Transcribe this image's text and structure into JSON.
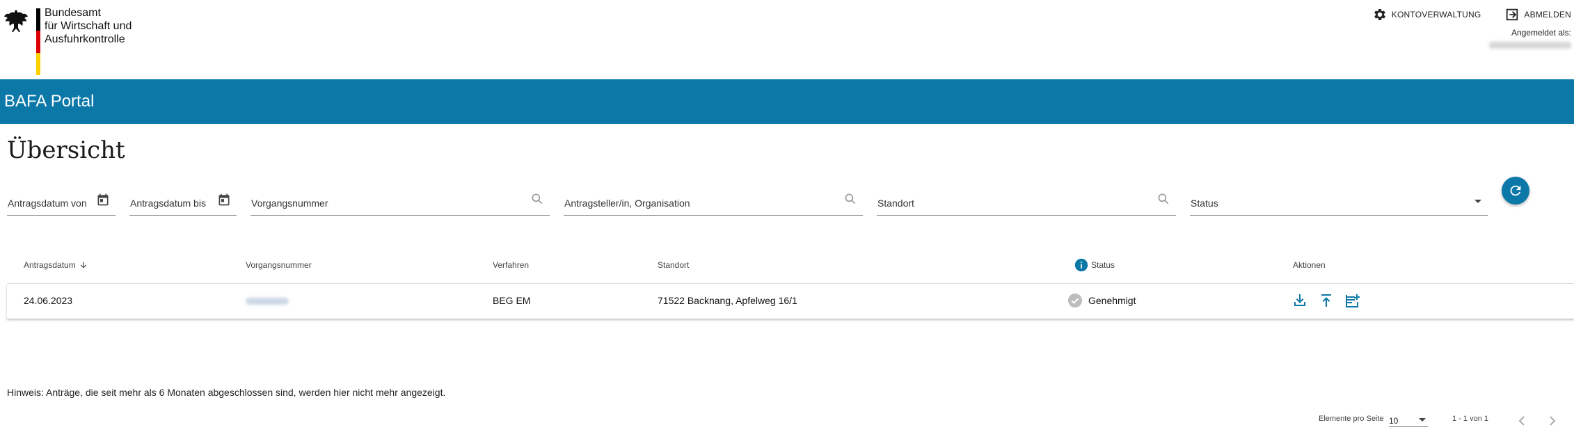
{
  "header": {
    "org_lines": [
      "Bundesamt",
      "für Wirtschaft und",
      "Ausfuhrkontrolle"
    ],
    "account_label": "KONTOVERWALTUNG",
    "logout_label": "ABMELDEN",
    "logged_in_label": "Angemeldet als:",
    "flag_colors": [
      "#000000",
      "#dd0000",
      "#ffce00"
    ]
  },
  "banner": {
    "title": "BAFA Portal",
    "color": "#0b78a8"
  },
  "page_title": "Übersicht",
  "filters": {
    "date_from": "Antragsdatum von",
    "date_to": "Antragsdatum bis",
    "case_number": "Vorgangsnummer",
    "applicant": "Antragsteller/in, Organisation",
    "location": "Standort",
    "status": "Status"
  },
  "table": {
    "headers": {
      "date": "Antragsdatum",
      "case_number": "Vorgangsnummer",
      "procedure": "Verfahren",
      "location": "Standort",
      "status": "Status",
      "actions": "Aktionen"
    },
    "rows": [
      {
        "date": "24.06.2023",
        "procedure": "BEG EM",
        "location": "71522 Backnang, Apfelweg 16/1",
        "status": "Genehmigt"
      }
    ],
    "action_icons": [
      "download-icon",
      "upload-icon",
      "add-note-icon"
    ]
  },
  "hint": "Hinweis: Anträge, die seit mehr als 6 Monaten abgeschlossen sind, werden hier nicht mehr angezeigt.",
  "pagination": {
    "per_page_label": "Elemente pro Seite",
    "per_page_value": "10",
    "range": "1 - 1 von 1"
  }
}
